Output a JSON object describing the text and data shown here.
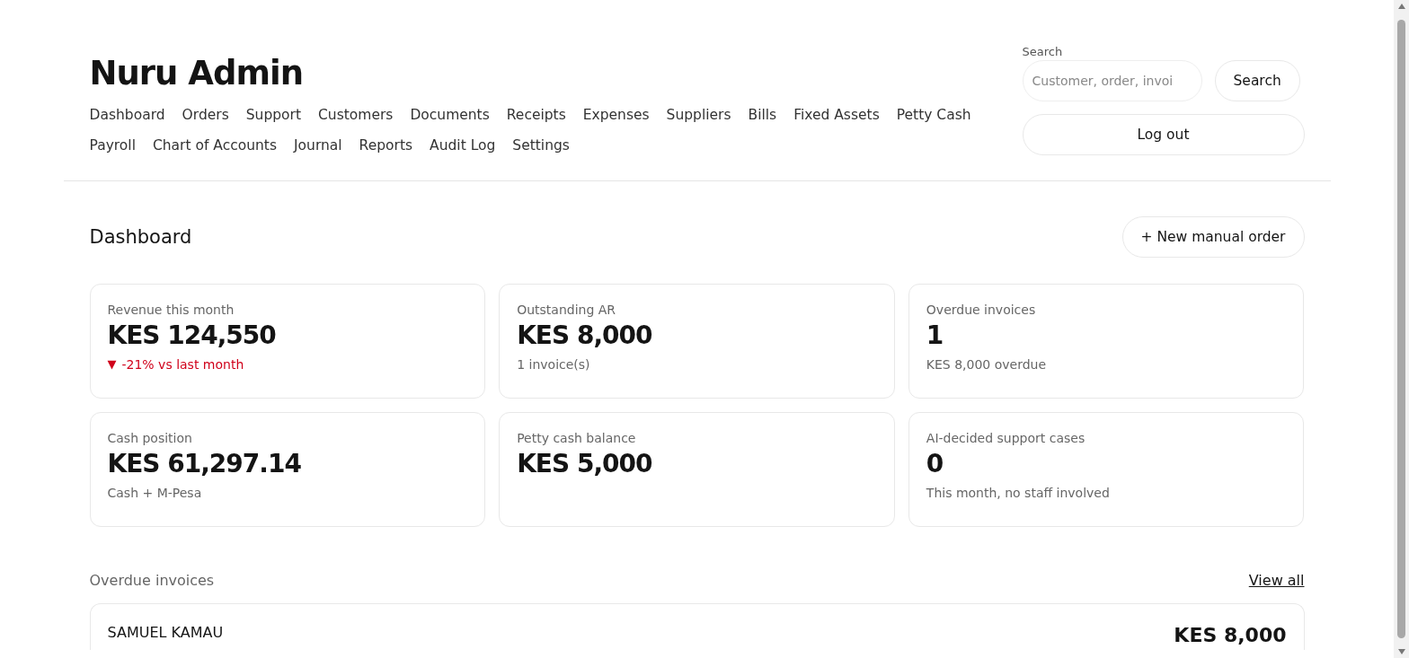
{
  "brand": "Nuru Admin",
  "nav": [
    {
      "label": "Dashboard"
    },
    {
      "label": "Orders"
    },
    {
      "label": "Support"
    },
    {
      "label": "Customers"
    },
    {
      "label": "Documents"
    },
    {
      "label": "Receipts"
    },
    {
      "label": "Expenses"
    },
    {
      "label": "Suppliers"
    },
    {
      "label": "Bills"
    },
    {
      "label": "Fixed Assets"
    },
    {
      "label": "Petty Cash"
    },
    {
      "label": "Payroll"
    },
    {
      "label": "Chart of Accounts"
    },
    {
      "label": "Journal"
    },
    {
      "label": "Reports"
    },
    {
      "label": "Audit Log"
    },
    {
      "label": "Settings"
    }
  ],
  "search": {
    "label": "Search",
    "placeholder": "Customer, order, invoi",
    "button": "Search"
  },
  "logout": "Log out",
  "page_title": "Dashboard",
  "new_order_button": "+ New manual order",
  "cards": [
    {
      "label": "Revenue this month",
      "value": "KES 124,550",
      "note": "-21% vs last month",
      "arrow": "▼",
      "kind": "negative"
    },
    {
      "label": "Outstanding AR",
      "value": "KES 8,000",
      "note": "1 invoice(s)",
      "kind": "neutral"
    },
    {
      "label": "Overdue invoices",
      "value": "1",
      "note": "KES 8,000 overdue",
      "kind": "neutral"
    },
    {
      "label": "Cash position",
      "value": "KES 61,297.14",
      "note": "Cash + M-Pesa",
      "kind": "neutral"
    },
    {
      "label": "Petty cash balance",
      "value": "KES 5,000"
    },
    {
      "label": "AI-decided support cases",
      "value": "0",
      "note": "This month, no staff involved",
      "kind": "neutral"
    }
  ],
  "overdue": {
    "title": "Overdue invoices",
    "link": "View all",
    "rows": [
      {
        "customer": "SAMUEL KAMAU",
        "amount": "KES 8,000"
      }
    ]
  }
}
